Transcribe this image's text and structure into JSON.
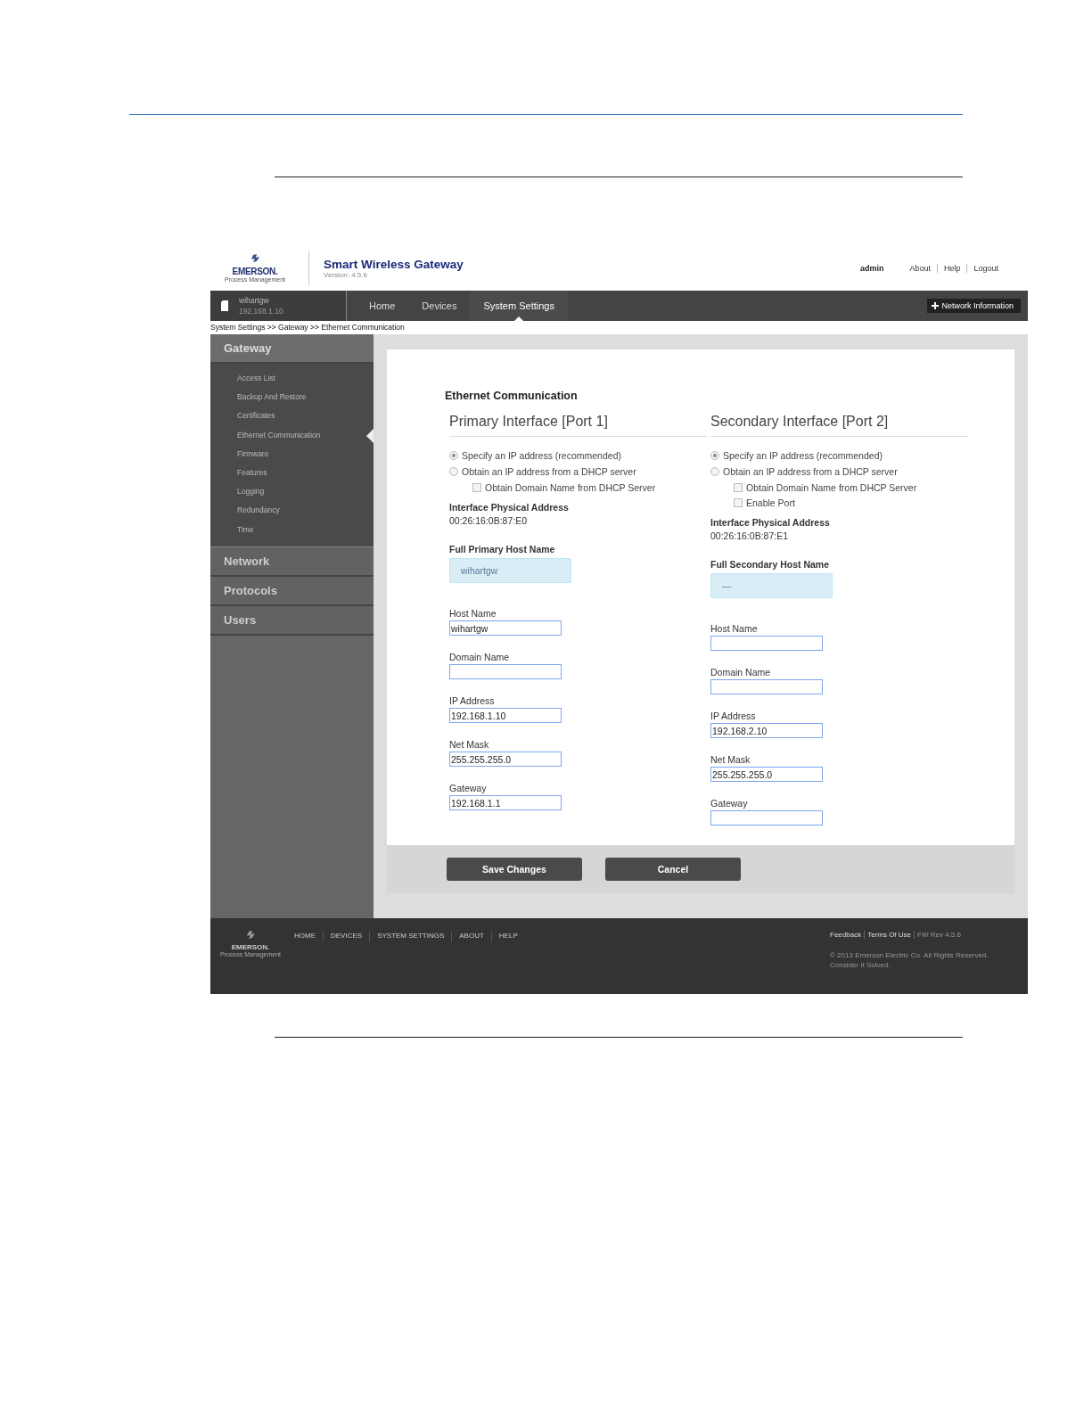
{
  "header": {
    "logo_text": "EMERSON.",
    "logo_subtext": "Process Management",
    "title": "Smart Wireless Gateway",
    "version": "Version: 4.5.6",
    "user": "admin",
    "links": [
      "About",
      "Help",
      "Logout"
    ]
  },
  "device": {
    "name": "wihartgw",
    "ip": "192.168.1.10"
  },
  "nav": [
    {
      "label": "Home",
      "selected": false
    },
    {
      "label": "Devices",
      "selected": false
    },
    {
      "label": "System Settings",
      "selected": true
    }
  ],
  "network_button": "Network Information",
  "breadcrumb": "System Settings >> Gateway >> Ethernet Communication",
  "sidebar": [
    {
      "label": "Gateway",
      "expanded": true,
      "children": [
        {
          "label": "Access List",
          "selected": false
        },
        {
          "label": "Backup And Restore",
          "selected": false
        },
        {
          "label": "Certificates",
          "selected": false
        },
        {
          "label": "Ethernet Communication",
          "selected": true
        },
        {
          "label": "Firmware",
          "selected": false
        },
        {
          "label": "Features",
          "selected": false
        },
        {
          "label": "Logging",
          "selected": false
        },
        {
          "label": "Redundancy",
          "selected": false
        },
        {
          "label": "Time",
          "selected": false
        }
      ]
    },
    {
      "label": "Network",
      "expanded": false
    },
    {
      "label": "Protocols",
      "expanded": false
    },
    {
      "label": "Users",
      "expanded": false
    }
  ],
  "form": {
    "title": "Ethernet Communication",
    "interfaces": [
      {
        "heading": "Primary Interface [Port 1]",
        "options": [
          {
            "kind": "radio",
            "label": "Specify an IP address (recommended)",
            "selected": true
          },
          {
            "kind": "radio",
            "label": "Obtain an IP address from a DHCP server",
            "selected": false
          },
          {
            "kind": "checkbox",
            "label": "Obtain Domain Name from DHCP Server",
            "checked": false
          }
        ],
        "mac_label": "Interface Physical Address",
        "mac": "00:26:16:0B:87:E0",
        "full_host_label": "Full Primary Host Name",
        "full_host": "wihartgw",
        "fields": [
          {
            "label": "Host Name",
            "value": "wihartgw"
          },
          {
            "label": "Domain Name"
          },
          {
            "label": "IP Address",
            "value": "192.168.1.10"
          },
          {
            "label": "Net Mask",
            "value": "255.255.255.0"
          },
          {
            "label": "Gateway",
            "value": "192.168.1.1"
          }
        ]
      },
      {
        "heading": "Secondary Interface [Port 2]",
        "options": [
          {
            "kind": "radio",
            "label": "Specify an IP address (recommended)",
            "selected": true
          },
          {
            "kind": "radio",
            "label": "Obtain an IP address from a DHCP server",
            "selected": false
          },
          {
            "kind": "checkbox",
            "label": "Obtain Domain Name from DHCP Server",
            "checked": false
          },
          {
            "kind": "checkbox",
            "label": "Enable Port",
            "checked": false
          }
        ],
        "mac_label": "Interface Physical Address",
        "mac": "00:26:16:0B:87:E1",
        "full_host_label": "Full Secondary Host Name",
        "full_host": "—",
        "fields": [
          {
            "label": "Host Name"
          },
          {
            "label": "Domain Name"
          },
          {
            "label": "IP Address",
            "value": "192.168.2.10"
          },
          {
            "label": "Net Mask",
            "value": "255.255.255.0"
          },
          {
            "label": "Gateway"
          }
        ]
      }
    ]
  },
  "buttons": [
    "Save Changes",
    "Cancel"
  ],
  "footer": {
    "logo_text": "EMERSON.",
    "logo_subtext": "Process Management",
    "links": [
      "HOME",
      "DEVICES",
      "SYSTEM SETTINGS",
      "ABOUT",
      "HELP"
    ],
    "legal_links": [
      "Feedback",
      "Terms Of Use"
    ],
    "fw": "FW Rev 4.5.6",
    "copyright": "© 2013 Emerson Electric Co. All Rights Reserved.",
    "slogan": "Consider It Solved."
  }
}
